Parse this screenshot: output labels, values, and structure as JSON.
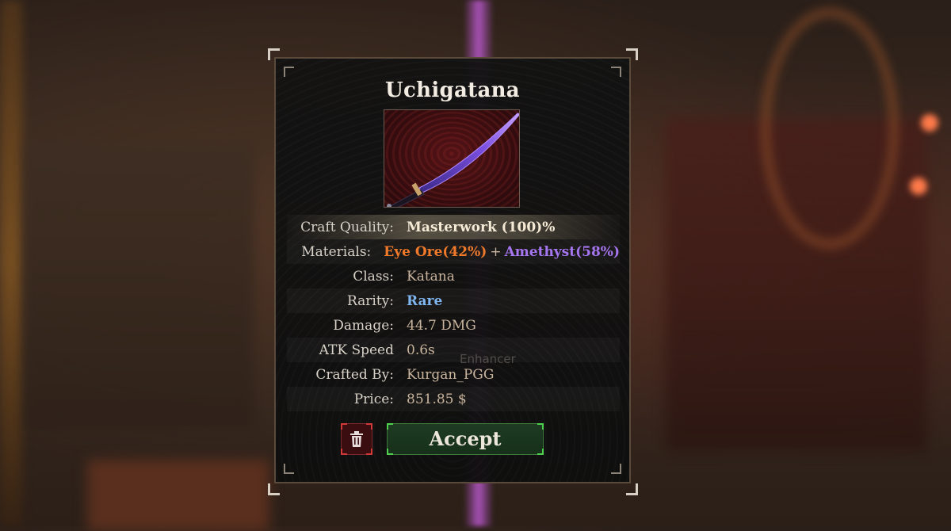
{
  "item": {
    "name": "Uchigatana",
    "icon": "katana-weapon-image"
  },
  "stats": {
    "craft_quality": {
      "label": "Craft Quality:",
      "value": "Masterwork (100)%"
    },
    "materials": {
      "label": "Materials:",
      "first": "Eye Ore(42%)",
      "joiner": "+",
      "second": "Amethyst(58%)"
    },
    "class": {
      "label": "Class:",
      "value": "Katana"
    },
    "rarity": {
      "label": "Rarity:",
      "value": "Rare"
    },
    "damage": {
      "label": "Damage:",
      "value": "44.7 DMG"
    },
    "atk_speed": {
      "label": "ATK Speed",
      "value": "0.6s"
    },
    "crafted_by": {
      "label": "Crafted By:",
      "value": "Kurgan_PGG"
    },
    "price": {
      "label": "Price:",
      "value": "851.85 $"
    }
  },
  "background_text": "Enhancer",
  "actions": {
    "delete_icon": "trash-icon",
    "accept_label": "Accept"
  },
  "colors": {
    "eye_ore": "#f07a2a",
    "amethyst": "#a675f0",
    "rare": "#7fb6f0",
    "accept": "#3f7a3c",
    "delete": "#d23a3a"
  }
}
